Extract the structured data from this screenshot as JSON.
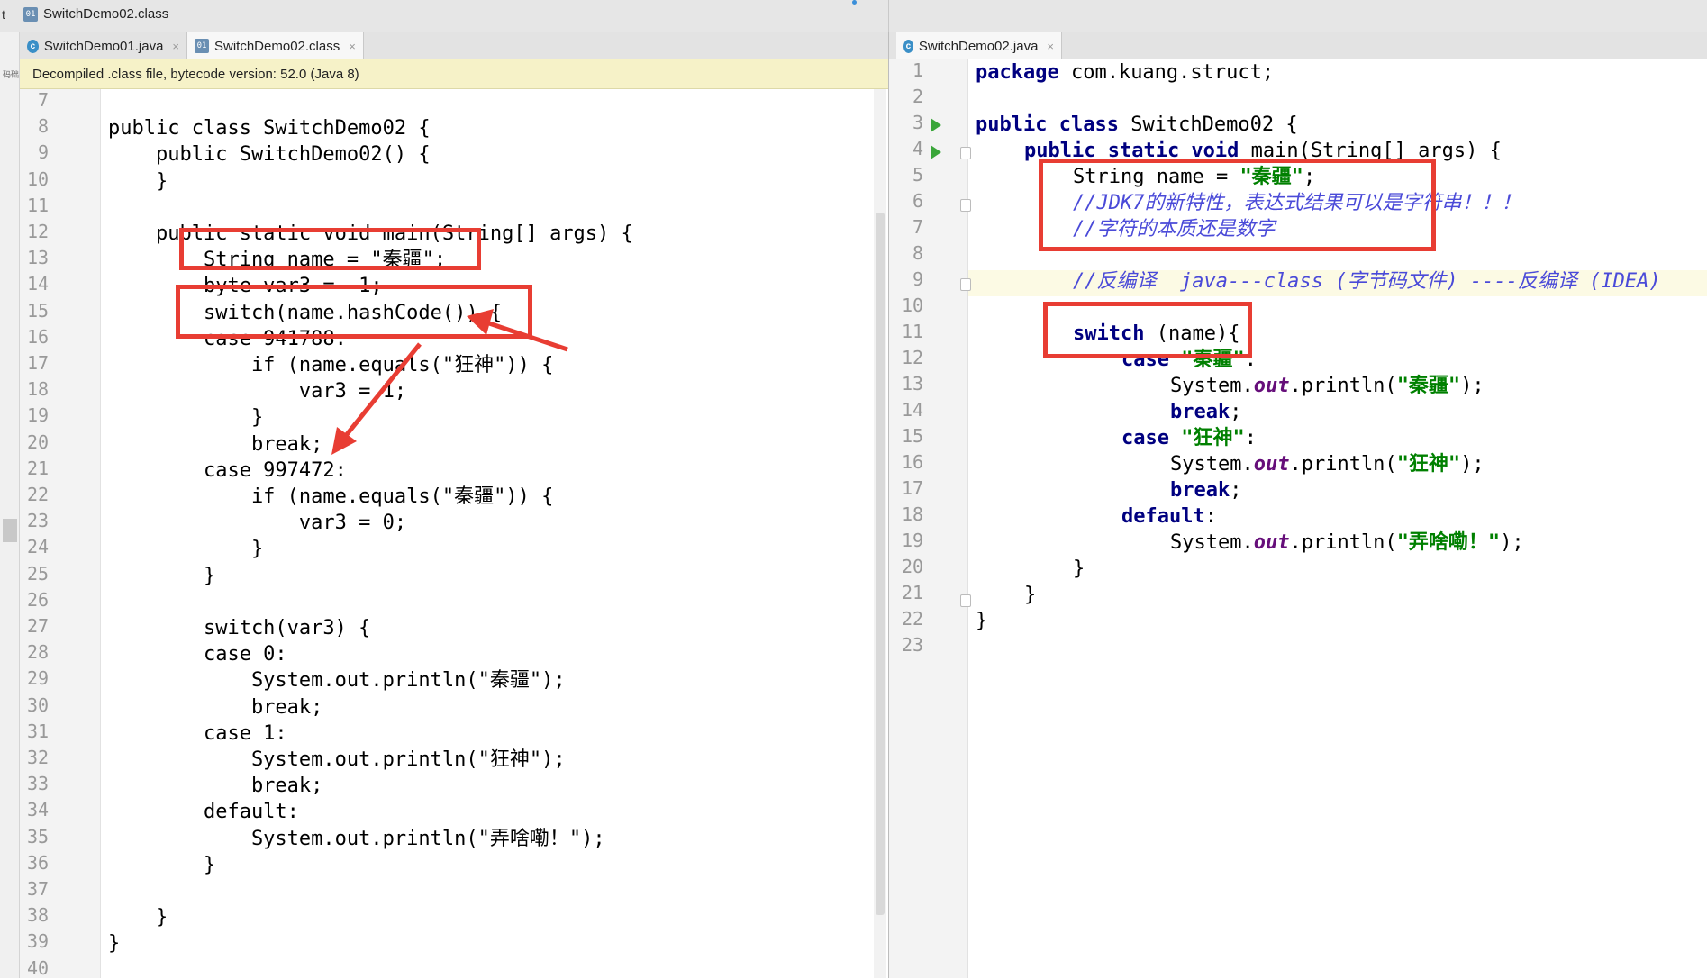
{
  "breadcrumb": {
    "project": "t",
    "file": "SwitchDemo02.class"
  },
  "left_tabs": [
    {
      "label": "SwitchDemo01.java",
      "type": "java"
    },
    {
      "label": "SwitchDemo02.class",
      "type": "class"
    }
  ],
  "right_tabs": [
    {
      "label": "SwitchDemo02.java",
      "type": "java"
    }
  ],
  "sidebar_label": "码础",
  "decompiled_banner": "Decompiled .class file, bytecode version: 52.0 (Java 8)",
  "left_line_numbers": [
    "7",
    "8",
    "9",
    "10",
    "11",
    "12",
    "13",
    "14",
    "15",
    "16",
    "17",
    "18",
    "19",
    "20",
    "21",
    "22",
    "23",
    "24",
    "25",
    "26",
    "27",
    "28",
    "29",
    "30",
    "31",
    "32",
    "33",
    "34",
    "35",
    "36",
    "37",
    "38",
    "39",
    "40"
  ],
  "left_code": [
    "",
    "public class SwitchDemo02 {",
    "    public SwitchDemo02() {",
    "    }",
    "",
    "    public static void main(String[] args) {",
    "        String name = \"秦疆\";",
    "        byte var3 = -1;",
    "        switch(name.hashCode()) {",
    "        case 941788:",
    "            if (name.equals(\"狂神\")) {",
    "                var3 = 1;",
    "            }",
    "            break;",
    "        case 997472:",
    "            if (name.equals(\"秦疆\")) {",
    "                var3 = 0;",
    "            }",
    "        }",
    "",
    "        switch(var3) {",
    "        case 0:",
    "            System.out.println(\"秦疆\");",
    "            break;",
    "        case 1:",
    "            System.out.println(\"狂神\");",
    "            break;",
    "        default:",
    "            System.out.println(\"弄啥嘞！\");",
    "        }",
    "",
    "    }",
    "}",
    ""
  ],
  "right_line_numbers": [
    "1",
    "2",
    "3",
    "4",
    "5",
    "6",
    "7",
    "8",
    "9",
    "10",
    "11",
    "12",
    "13",
    "14",
    "15",
    "16",
    "17",
    "18",
    "19",
    "20",
    "21",
    "22",
    "23"
  ],
  "right_code": {
    "l1_kw": "package",
    "l1_rest": " com.kuang.struct;",
    "l3_kw": "public class",
    "l3_rest": " SwitchDemo02 {",
    "l4_kw": "public static void",
    "l4_rest": " main(String[] args) {",
    "l5_pre": "String name = ",
    "l5_str": "\"秦疆\"",
    "l5_post": ";",
    "l6_cmt": "//JDK7的新特性，表达式结果可以是字符串！！！",
    "l7_cmt": "//字符的本质还是数字",
    "l9_cmt": "//反编译  java---class (字节码文件) ----反编译 (IDEA)",
    "l11_kw": "switch",
    "l11_rest": " (name){",
    "l12_kw": "case",
    "l12_str": "\"秦疆\"",
    "l12_post": ":",
    "l13_pre": "System.",
    "l13_out": "out",
    "l13_mid": ".println(",
    "l13_str": "\"秦疆\"",
    "l13_post": ");",
    "l14_kw": "break",
    "l14_post": ";",
    "l15_kw": "case",
    "l15_str": "\"狂神\"",
    "l15_post": ":",
    "l16_pre": "System.",
    "l16_out": "out",
    "l16_mid": ".println(",
    "l16_str": "\"狂神\"",
    "l16_post": ");",
    "l17_kw": "break",
    "l17_post": ";",
    "l18_kw": "default",
    "l18_post": ":",
    "l19_pre": "System.",
    "l19_out": "out",
    "l19_mid": ".println(",
    "l19_str": "\"弄啥嘞！\"",
    "l19_post": ");",
    "l20": "}",
    "l21": "}",
    "l22": "}"
  },
  "colors": {
    "keyword": "#000080",
    "string": "#008000",
    "comment": "#4a4ad8",
    "annotation_red": "#e83d33",
    "banner_bg": "#f6f2c8"
  }
}
